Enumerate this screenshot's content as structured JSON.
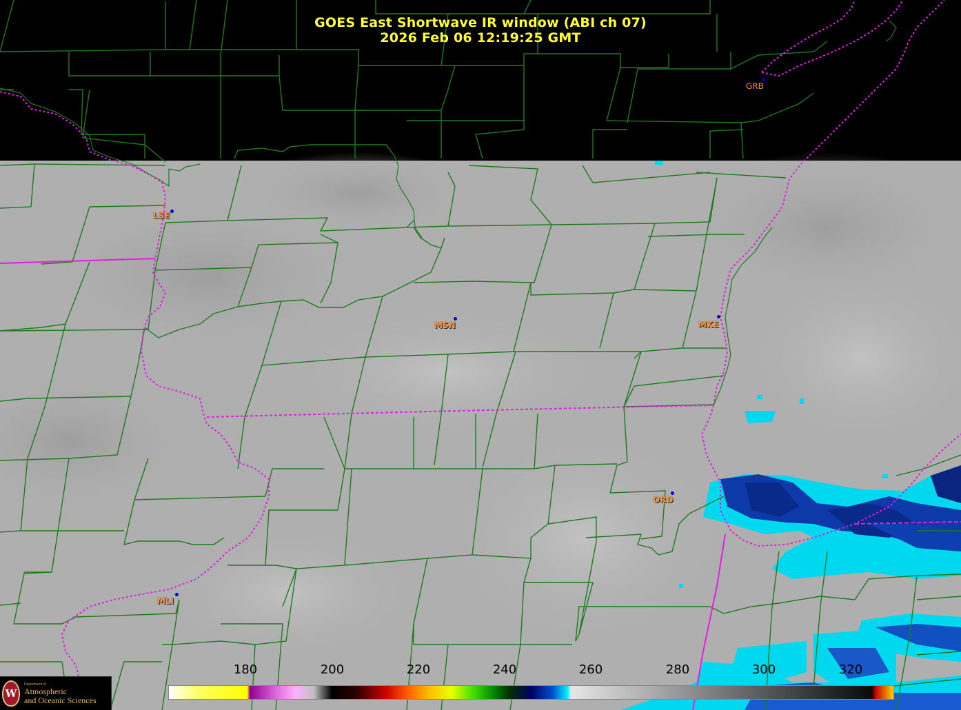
{
  "title": {
    "line1": "GOES East Shortwave IR window (ABI ch 07)",
    "line2": "2026 Feb 06  12:19:25 GMT"
  },
  "cities": [
    {
      "id": "grb",
      "label": "GRB"
    },
    {
      "id": "lse",
      "label": "LSE"
    },
    {
      "id": "msn",
      "label": "MSN"
    },
    {
      "id": "mke",
      "label": "MKE"
    },
    {
      "id": "ord",
      "label": "ORD"
    },
    {
      "id": "mli",
      "label": "MLI"
    }
  ],
  "colorbar": {
    "ticks": [
      "180",
      "200",
      "220",
      "240",
      "260",
      "280",
      "300",
      "320"
    ]
  },
  "logo": {
    "small_text": "Department of",
    "line1": "Atmospheric",
    "line2": "and Oceanic Sciences"
  },
  "colors": {
    "title": "#ffff33",
    "city_label": "#ff9a3c",
    "county_lines": "#1f7a1f",
    "state_lines": "#e020e0",
    "cloud_blue": "#0a2f9a",
    "cloud_cyan": "#00e8ff",
    "no_data": "#000000",
    "ir_background": "#b0b0b0"
  }
}
